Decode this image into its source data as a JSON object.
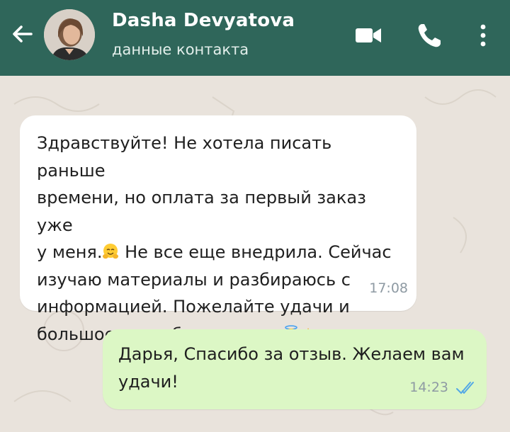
{
  "header": {
    "back_icon": "arrow-left-icon",
    "contact_name": "Dasha Devyatova",
    "subtitle": "данные контакта",
    "video_icon": "video-call-icon",
    "call_icon": "phone-icon",
    "more_icon": "more-vertical-icon",
    "colors": {
      "bar": "#2f665a",
      "text": "#ffffff"
    }
  },
  "messages": [
    {
      "direction": "incoming",
      "text_lines": [
        "Здравствуйте! Не хотела писать раньше",
        "времени, но оплата за первый заказ уже",
        "у меня.",
        "Не все еще внедрила. Сейчас",
        "изучаю материалы и разбираюсь с",
        "информацией. Пожелайте удачи и",
        "большое спасибо от души."
      ],
      "emojis": [
        "hugging-face-emoji",
        "smiling-face-with-halo-emoji",
        "folded-hands-emoji"
      ],
      "time": "17:08"
    },
    {
      "direction": "outgoing",
      "text_lines": [
        "Дарья, Спасибо за отзыв. Желаем вам",
        "удачи!"
      ],
      "time": "14:23",
      "status_icon": "double-check-read-icon"
    }
  ],
  "colors": {
    "incoming_bg": "#ffffff",
    "outgoing_bg": "#dcf7c5",
    "read_ticks": "#53a8e6"
  }
}
